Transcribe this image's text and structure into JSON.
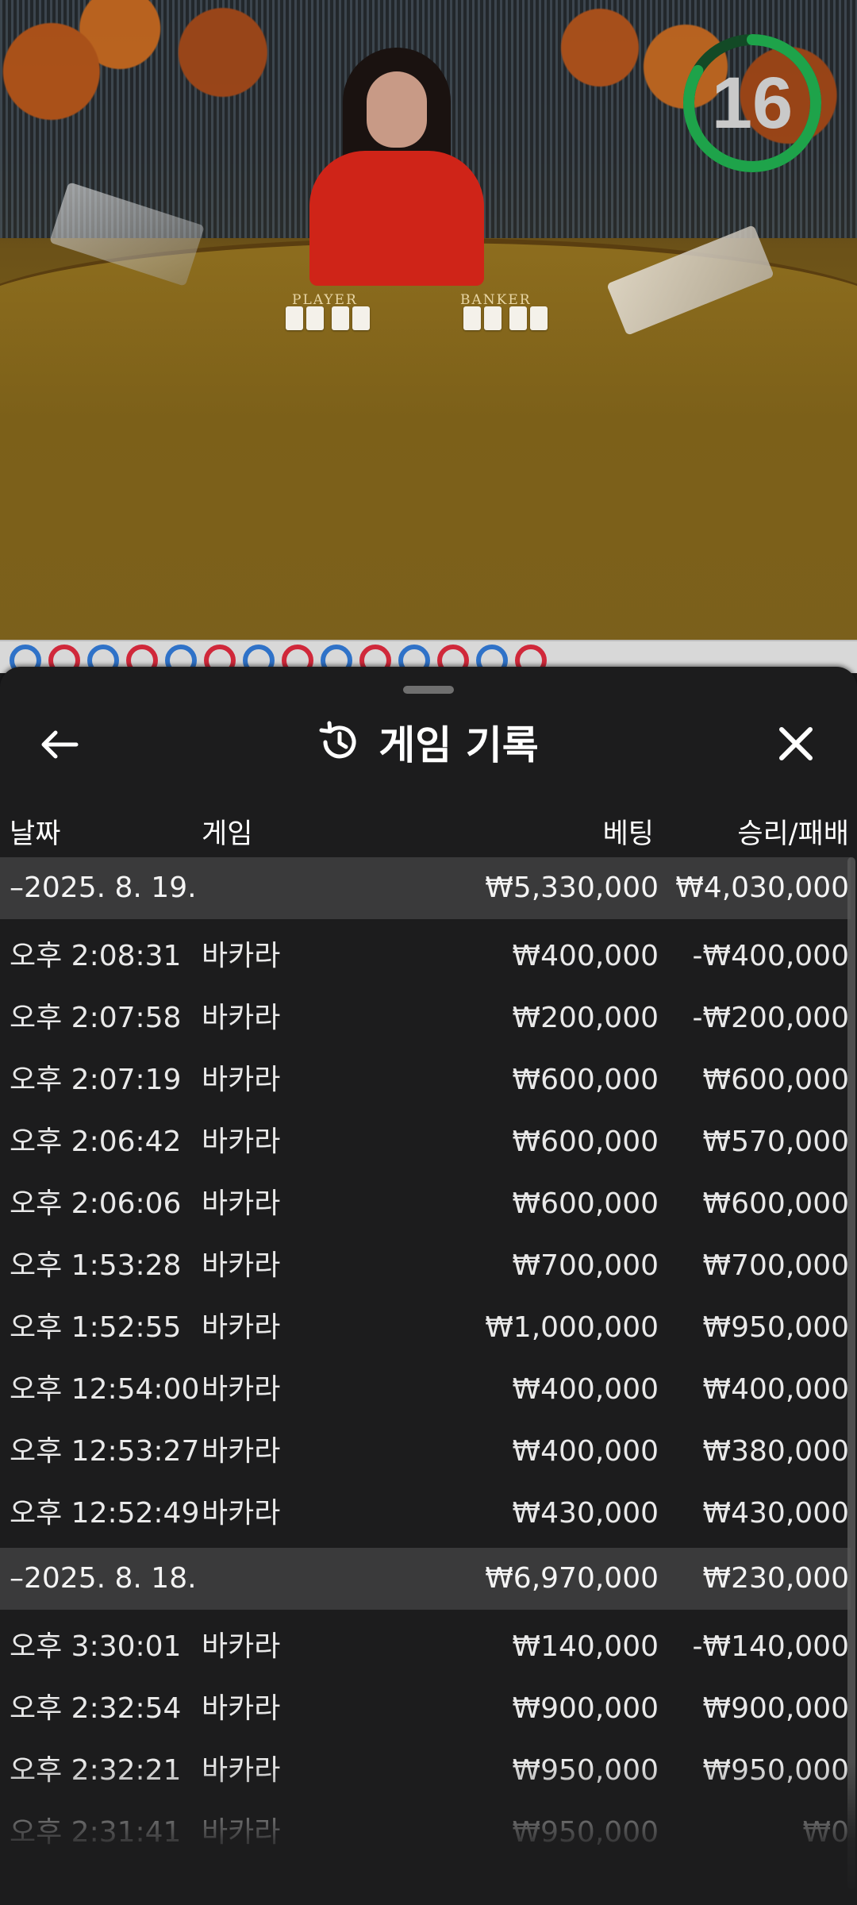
{
  "video": {
    "timer_value": "16",
    "table_labels": {
      "player": "PLAYER",
      "banker": "BANKER"
    }
  },
  "road": {
    "cells": [
      "blue",
      "red",
      "blue",
      "red",
      "blue",
      "red",
      "blue",
      "red",
      "blue",
      "red",
      "blue",
      "red",
      "blue",
      "red"
    ]
  },
  "sheet": {
    "title": "게임 기록",
    "icons": {
      "back": "arrow-left-icon",
      "history": "history-icon",
      "close": "close-icon"
    },
    "columns": {
      "date": "날짜",
      "game": "게임",
      "bet": "베팅",
      "winloss": "승리/패배"
    },
    "groups": [
      {
        "date": "–2025. 8. 19.",
        "bet_total": "₩5,330,000",
        "winloss_total": "₩4,030,000",
        "rows": [
          {
            "time": "오후 2:08:31",
            "game": "바카라",
            "bet": "₩400,000",
            "winloss": "-₩400,000"
          },
          {
            "time": "오후 2:07:58",
            "game": "바카라",
            "bet": "₩200,000",
            "winloss": "-₩200,000"
          },
          {
            "time": "오후 2:07:19",
            "game": "바카라",
            "bet": "₩600,000",
            "winloss": "₩600,000"
          },
          {
            "time": "오후 2:06:42",
            "game": "바카라",
            "bet": "₩600,000",
            "winloss": "₩570,000"
          },
          {
            "time": "오후 2:06:06",
            "game": "바카라",
            "bet": "₩600,000",
            "winloss": "₩600,000"
          },
          {
            "time": "오후 1:53:28",
            "game": "바카라",
            "bet": "₩700,000",
            "winloss": "₩700,000"
          },
          {
            "time": "오후 1:52:55",
            "game": "바카라",
            "bet": "₩1,000,000",
            "winloss": "₩950,000"
          },
          {
            "time": "오후 12:54:00",
            "game": "바카라",
            "bet": "₩400,000",
            "winloss": "₩400,000"
          },
          {
            "time": "오후 12:53:27",
            "game": "바카라",
            "bet": "₩400,000",
            "winloss": "₩380,000"
          },
          {
            "time": "오후 12:52:49",
            "game": "바카라",
            "bet": "₩430,000",
            "winloss": "₩430,000"
          }
        ]
      },
      {
        "date": "–2025. 8. 18.",
        "bet_total": "₩6,970,000",
        "winloss_total": "₩230,000",
        "rows": [
          {
            "time": "오후 3:30:01",
            "game": "바카라",
            "bet": "₩140,000",
            "winloss": "-₩140,000"
          },
          {
            "time": "오후 2:32:54",
            "game": "바카라",
            "bet": "₩900,000",
            "winloss": "₩900,000"
          },
          {
            "time": "오후 2:32:21",
            "game": "바카라",
            "bet": "₩950,000",
            "winloss": "₩950,000"
          },
          {
            "time": "오후 2:31:41",
            "game": "바카라",
            "bet": "₩950,000",
            "winloss": "₩0"
          }
        ]
      }
    ]
  },
  "colors": {
    "sheet_bg": "#1c1c1d",
    "group_row_bg": "#3a3a3b",
    "timer_ring": "#1ea34a",
    "road_blue": "#2f72c8",
    "road_red": "#d0283a"
  }
}
